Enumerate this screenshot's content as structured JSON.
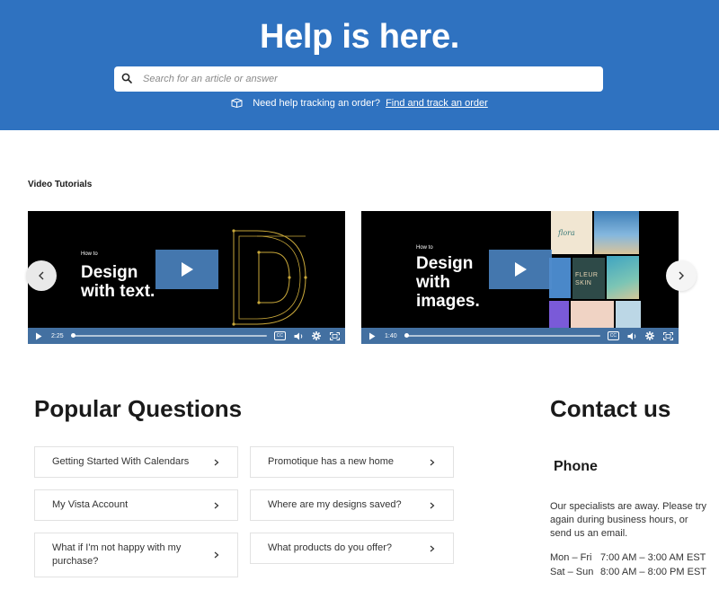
{
  "hero": {
    "title": "Help is here.",
    "search_placeholder": "Search for an article or answer",
    "track_text": "Need help tracking an order?",
    "track_link": "Find and track an order",
    "bg_color": "#2f72c0"
  },
  "videos": {
    "section_label": "Video Tutorials",
    "items": [
      {
        "howto": "How to",
        "title_line1": "Design",
        "title_line2": "with text.",
        "time": "2:25"
      },
      {
        "howto": "How to",
        "title_line1": "Design",
        "title_line2": "with",
        "title_line3": "images.",
        "time": "1:40",
        "thumbs": {
          "flora": "flora",
          "fleur": "FLEUR",
          "skin": "SKIN"
        }
      }
    ],
    "cc_label": "CC"
  },
  "popular": {
    "title": "Popular Questions",
    "questions": [
      "Getting Started With Calendars",
      "Promotique has a new home",
      "My Vista Account",
      "Where are my designs saved?",
      "What if I'm not happy with my purchase?",
      "What products do you offer?"
    ]
  },
  "contact": {
    "title": "Contact us",
    "phone_title": "Phone",
    "message": "Our specialists are away. Please try again during business hours, or send us an email.",
    "hours": [
      {
        "days": "Mon – Fri",
        "time": "7:00 AM – 3:00 AM EST"
      },
      {
        "days": "Sat – Sun",
        "time": "8:00 AM – 8:00 PM EST"
      }
    ]
  }
}
